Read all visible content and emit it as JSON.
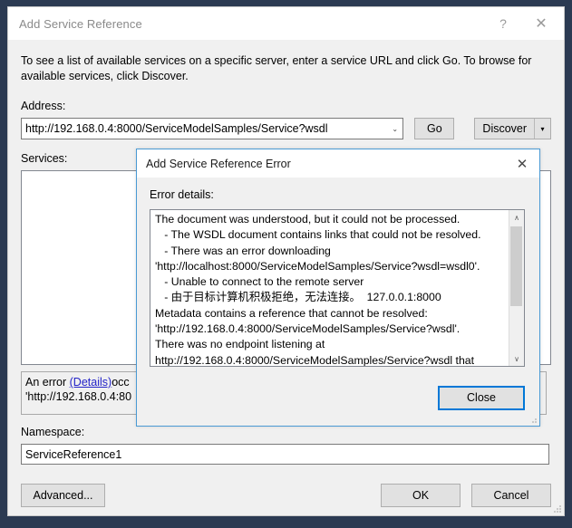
{
  "window": {
    "title": "Add Service Reference",
    "help_icon": "?",
    "close_icon": "✕",
    "accent_color": "#0078d7",
    "backdrop_color": "#2b3a52"
  },
  "main": {
    "intro": "To see a list of available services on a specific server, enter a service URL and click Go. To browse for available services, click Discover.",
    "address_label": "Address:",
    "address_value": "http://192.168.0.4:8000/ServiceModelSamples/Service?wsdl",
    "combo_arrow_icon": "⌄",
    "go_label": "Go",
    "discover_label": "Discover",
    "discover_arrow_icon": "▾",
    "services_label": "Services:",
    "status_line1_prefix": "An error ",
    "status_details_link": "(Details)",
    "status_line1_suffix": "occ",
    "status_line2": "'http://192.168.0.4:80",
    "namespace_label": "Namespace:",
    "namespace_value": "ServiceReference1",
    "advanced_label": "Advanced...",
    "ok_label": "OK",
    "cancel_label": "Cancel"
  },
  "error_dialog": {
    "title": "Add Service Reference Error",
    "close_icon": "✕",
    "details_label": "Error details:",
    "details_text": "The document was understood, but it could not be processed.\n   - The WSDL document contains links that could not be resolved.\n   - There was an error downloading\n'http://localhost:8000/ServiceModelSamples/Service?wsdl=wsdl0'.\n   - Unable to connect to the remote server\n   - 由于目标计算机积极拒绝，无法连接。  127.0.0.1:8000\nMetadata contains a reference that cannot be resolved:\n'http://192.168.0.4:8000/ServiceModelSamples/Service?wsdl'.\nThere was no endpoint listening at\nhttp://192.168.0.4:8000/ServiceModelSamples/Service?wsdl that",
    "scroll_up_icon": "∧",
    "scroll_down_icon": "∨",
    "close_button_label": "Close"
  }
}
